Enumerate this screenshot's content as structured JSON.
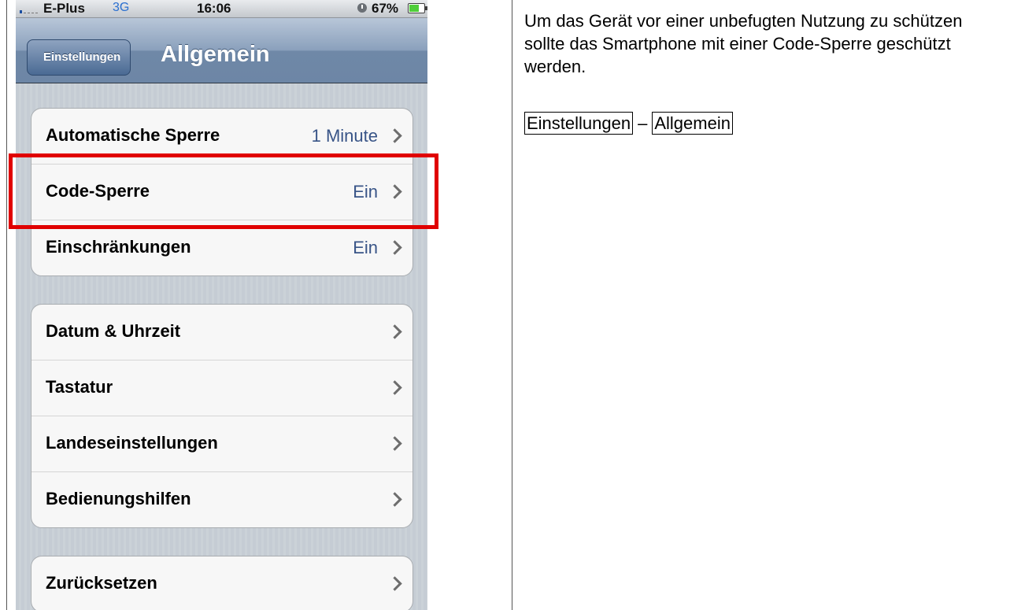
{
  "status_bar": {
    "carrier": "E-Plus",
    "network": "3G",
    "time": "16:06",
    "battery": "67%"
  },
  "navbar": {
    "back_label": "Einstellungen",
    "title": "Allgemein"
  },
  "groups": [
    {
      "rows": [
        {
          "label": "Automatische Sperre",
          "value": "1 Minute"
        },
        {
          "label": "Code-Sperre",
          "value": "Ein"
        },
        {
          "label": "Einschränkungen",
          "value": "Ein"
        }
      ]
    },
    {
      "rows": [
        {
          "label": "Datum & Uhrzeit",
          "value": ""
        },
        {
          "label": "Tastatur",
          "value": ""
        },
        {
          "label": "Landeseinstellungen",
          "value": ""
        },
        {
          "label": "Bedienungshilfen",
          "value": ""
        }
      ]
    },
    {
      "rows": [
        {
          "label": "Zurücksetzen",
          "value": ""
        }
      ]
    }
  ],
  "highlight_color": "#e00000",
  "description": "Um das Gerät vor einer unbefugten Nutzung zu schützen sollte das Smartphone mit einer Code-Sperre geschützt werden.",
  "path": {
    "step1": "Einstellungen",
    "separator": "–",
    "step2": "Allgemein"
  }
}
